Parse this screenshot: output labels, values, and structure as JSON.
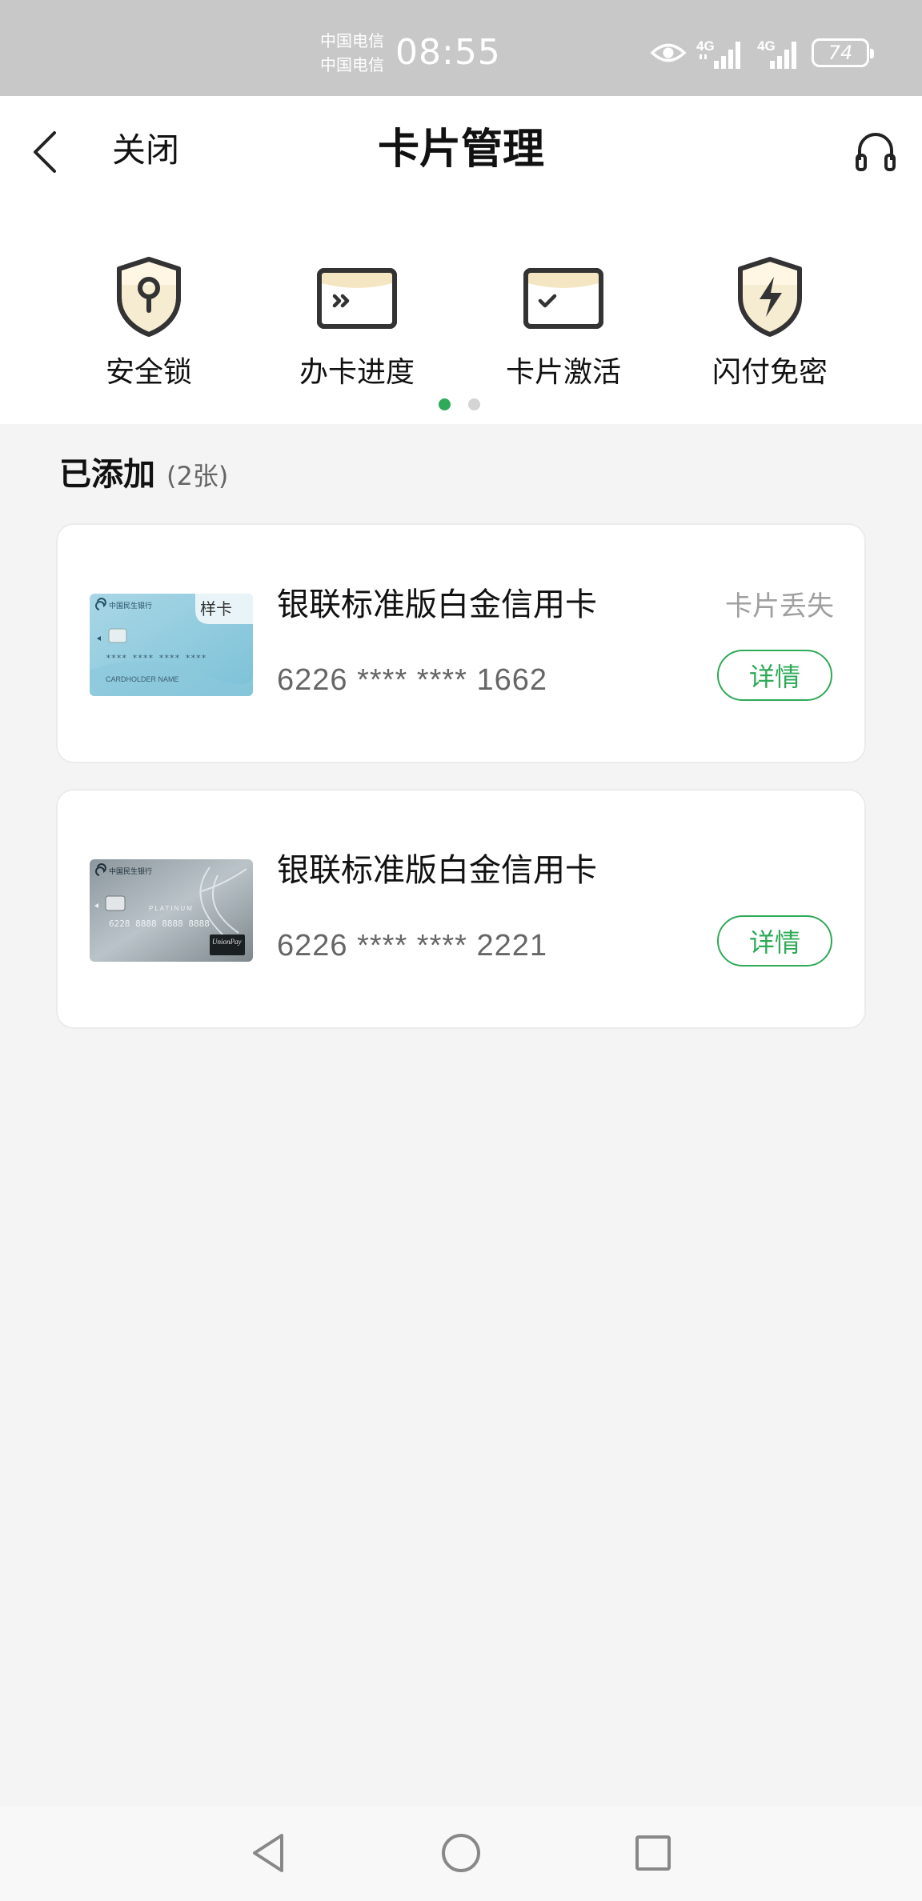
{
  "status_bar": {
    "carrier_1": "中国电信",
    "carrier_2": "中国电信",
    "time": "08:55",
    "network_1": "4G",
    "network_2": "4G",
    "battery": "74"
  },
  "header": {
    "close_label": "关闭",
    "title": "卡片管理",
    "back_icon": "chevron-left-icon",
    "service_icon": "headset-icon"
  },
  "actions": [
    {
      "label": "安全锁",
      "icon": "shield-lock-icon"
    },
    {
      "label": "办卡进度",
      "icon": "progress-card-icon"
    },
    {
      "label": "卡片激活",
      "icon": "activate-card-icon"
    },
    {
      "label": "闪付免密",
      "icon": "shield-lightning-icon"
    }
  ],
  "pager": {
    "page_count": 2,
    "active_index": 0
  },
  "section": {
    "title": "已添加",
    "count": "(2张)"
  },
  "cards": [
    {
      "name": "银联标准版白金信用卡",
      "number": "6226 **** **** 1662",
      "status": "卡片丢失",
      "detail_label": "详情",
      "image": {
        "bank": "中国民生银行",
        "sample_label": "样卡",
        "number_mask": "****  ****  ****  ****",
        "holder": "CARDHOLDER NAME"
      }
    },
    {
      "name": "银联标准版白金信用卡",
      "number": "6226 **** **** 2221",
      "status": "",
      "detail_label": "详情",
      "image": {
        "bank": "中国民生银行",
        "tier": "PLATINUM",
        "number_mask": "6228  8888  8888  8888",
        "brand": "UnionPay"
      }
    }
  ],
  "colors": {
    "accent": "#2eaa58",
    "status_bar": "#c8c8c8",
    "page_bg": "#f4f4f4"
  }
}
